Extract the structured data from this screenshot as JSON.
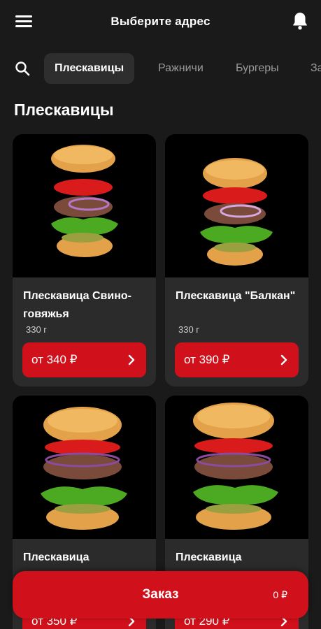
{
  "header": {
    "address_label": "Выберите адрес"
  },
  "tabs": [
    {
      "label": "Плескавицы",
      "active": true
    },
    {
      "label": "Ражничи",
      "active": false
    },
    {
      "label": "Бургеры",
      "active": false
    },
    {
      "label": "За",
      "active": false
    }
  ],
  "section": {
    "title": "Плескавицы"
  },
  "products": [
    {
      "name": "Плескавица Свино-говяжья",
      "weight": "330 г",
      "price": "от 340 ₽"
    },
    {
      "name": "Плескавица \"Балкан\"",
      "weight": "330 г",
      "price": "от 390 ₽"
    },
    {
      "name": "Плескавица",
      "weight": "",
      "price": "от 350 ₽"
    },
    {
      "name": "Плескавица",
      "weight": "",
      "price": "от 290 ₽"
    }
  ],
  "order": {
    "label": "Заказ",
    "total": "0 ₽"
  },
  "colors": {
    "accent": "#d0101a",
    "background": "#1a1a1a",
    "card": "#2b2b2b"
  },
  "icons": [
    "menu-icon",
    "bell-icon",
    "search-icon",
    "chevron-right-icon",
    "burger-image"
  ]
}
